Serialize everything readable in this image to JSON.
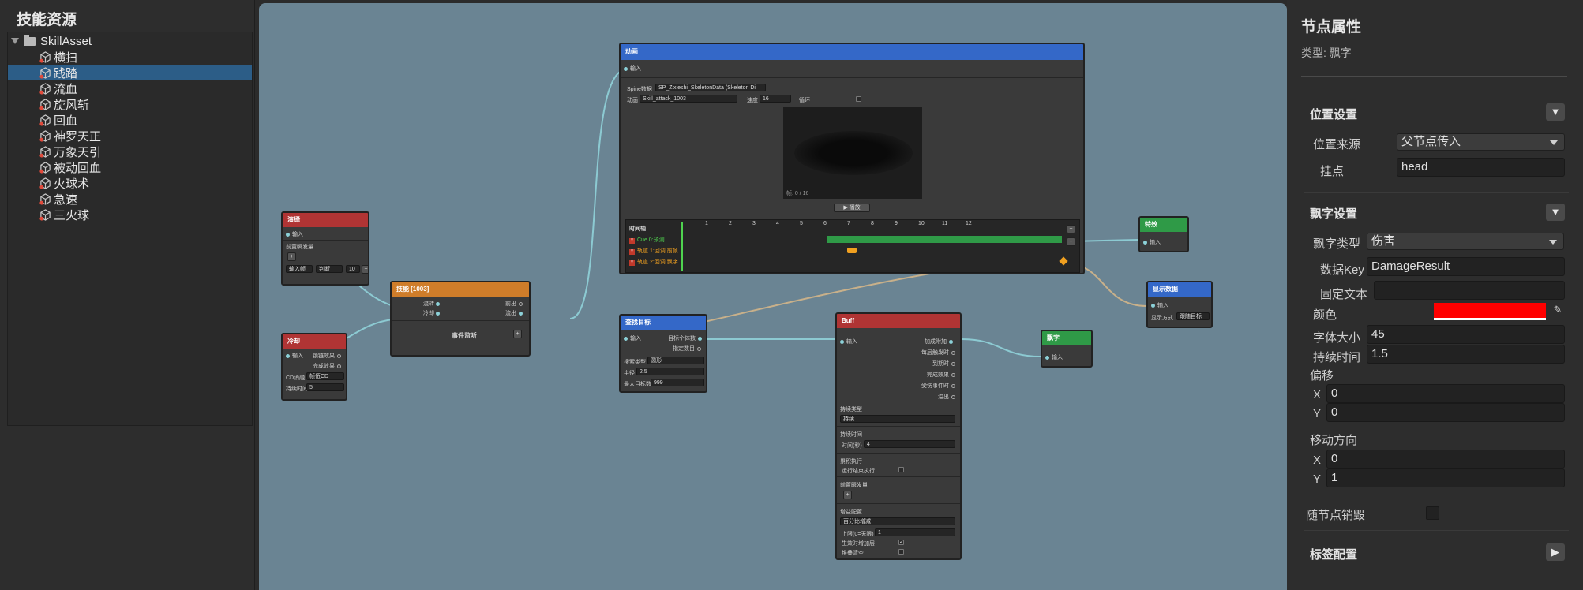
{
  "left_panel": {
    "title": "技能资源",
    "root": "SkillAsset",
    "items": [
      "横扫",
      "践踏",
      "流血",
      "旋风斩",
      "回血",
      "神罗天正",
      "万象天引",
      "被动回血",
      "火球术",
      "急速",
      "三火球"
    ],
    "selected_index": 1
  },
  "nodes": {
    "cast": {
      "title": "演绎",
      "in": "输入",
      "field": "前置瞬发量",
      "add": "+",
      "opt1": "输入帧",
      "opt2": "判断",
      "num": "10",
      "btn": "+"
    },
    "cooldown": {
      "title": "冷却",
      "in": "输入",
      "c1": "锁链效果",
      "c2": "完成效果",
      "cd_label": "CD消融",
      "cd_val": "帧伍CD",
      "time_label": "持续时间",
      "time_val": "5"
    },
    "skill": {
      "title": "技能 [1003]",
      "l1": "流转",
      "l2": "冷却",
      "r1": "前出",
      "r2": "流出",
      "event": "事件监听",
      "plus": "+"
    },
    "anim": {
      "title": "动画",
      "in": "输入",
      "spine_label": "Spine数据",
      "spine_val": "SP_Zixieshi_SkeletonData (Skeleton Di",
      "anim_label": "动画",
      "anim_val": "Skill_attack_1003",
      "speed_label": "速度",
      "speed_val": "16",
      "loop_label": "循环",
      "frame_label": "帧: 0 / 16",
      "play_btn": "▶ 播放",
      "tl_title": "时间轴",
      "tl_marks": [
        "1",
        "2",
        "3",
        "4",
        "5",
        "6",
        "7",
        "8",
        "9",
        "10",
        "11",
        "12"
      ],
      "tracks": [
        "Cue 0:预测",
        "轨道 1:回调 前帧",
        "轨道 2:回调 飘字"
      ]
    },
    "search": {
      "title": "查找目标",
      "in": "输入",
      "out1": "目标个体数",
      "out2": "指定数目",
      "f1": "搜索类型",
      "f1v": "圆形",
      "f2": "半径",
      "f2v": "2.5",
      "f3": "最大目标数",
      "f3v": "999"
    },
    "buff": {
      "title": "Buff",
      "in": "输入",
      "outs": [
        "加成附加",
        "每层触发时",
        "到期时",
        "完成效果",
        "受伤事件时",
        "溢出"
      ],
      "s1": "持续类型",
      "s1v": "持续",
      "s2": "持续时间",
      "s2l": "时间(秒)",
      "s2v": "4",
      "s3": "累积执行",
      "s3l": "运行结束执行",
      "s4": "前置瞬发量",
      "s5": "增益配置",
      "s5v": "百分比增减",
      "s5l1": "上限(0=无限)",
      "s5v1": "1",
      "s5l2": "生效时增加层",
      "s5l3": "堆叠清空"
    },
    "effect": {
      "title": "特效",
      "in": "输入"
    },
    "float": {
      "title": "飘字",
      "in": "输入"
    },
    "show": {
      "title": "显示数据",
      "in": "输入",
      "f": "显示方式",
      "fv": "跟随目标"
    }
  },
  "right_panel": {
    "title": "节点属性",
    "type_label": "类型: 飘字",
    "pos_section": "位置设置",
    "pos_source_label": "位置来源",
    "pos_source_value": "父节点传入",
    "anchor_label": "挂点",
    "anchor_value": "head",
    "float_section": "飘字设置",
    "float_type_label": "飘字类型",
    "float_type_value": "伤害",
    "data_key_label": "数据Key",
    "data_key_value": "DamageResult",
    "fixed_text_label": "固定文本",
    "fixed_text_value": "",
    "color_label": "颜色",
    "color_value": "#ff0000",
    "font_size_label": "字体大小",
    "font_size_value": "45",
    "duration_label": "持续时间",
    "duration_value": "1.5",
    "offset_label": "偏移",
    "offset_x": "0",
    "offset_y": "0",
    "move_label": "移动方向",
    "move_x": "0",
    "move_y": "1",
    "x_label": "X",
    "y_label": "Y",
    "destroy_label": "随节点销毁",
    "tag_section": "标签配置",
    "fold_down": "▼",
    "fold_right": "▶",
    "picker_icon": "✎"
  }
}
